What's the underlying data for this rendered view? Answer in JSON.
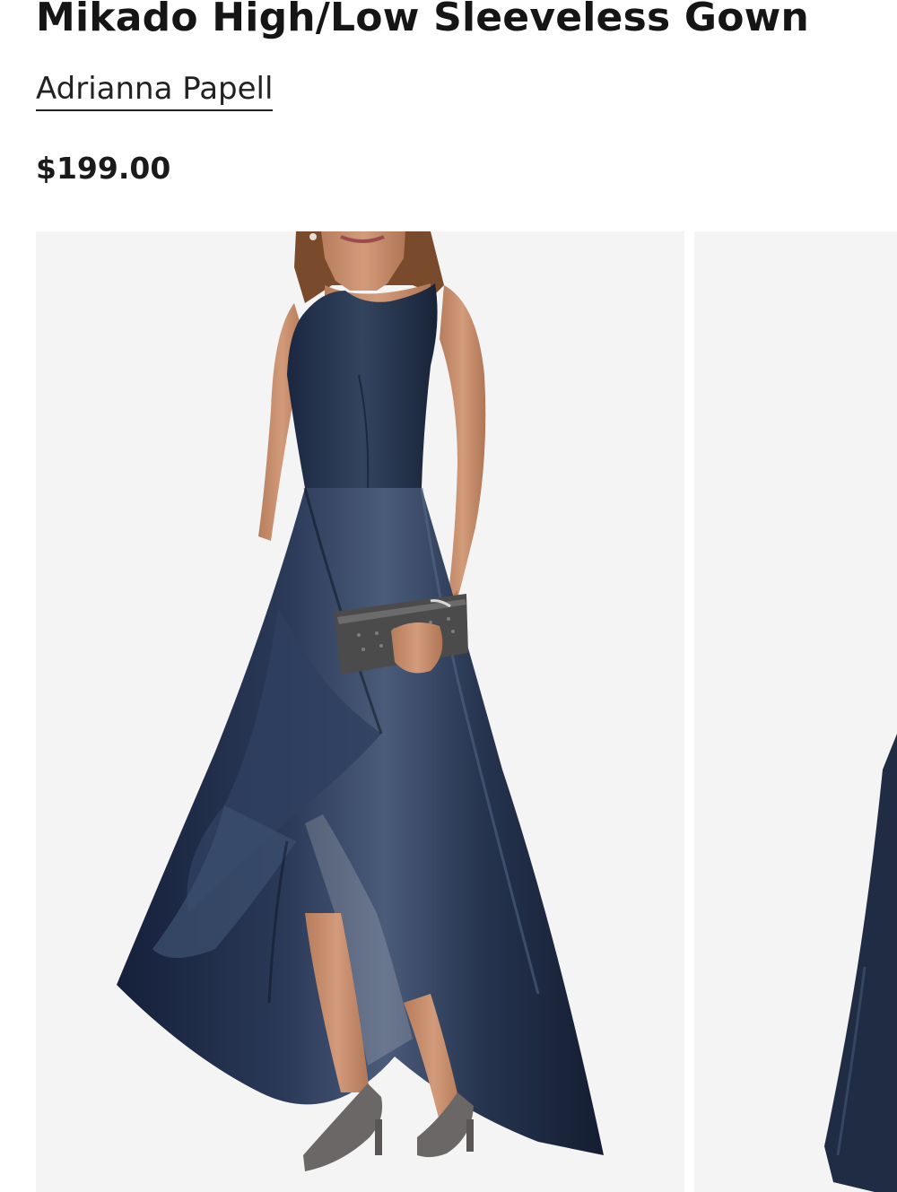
{
  "product": {
    "title": "Mikado High/Low Sleeveless Gown",
    "brand": "Adrianna Papell",
    "price": "$199.00"
  },
  "gallery": {
    "images": [
      {
        "label": "navy high-low sleeveless gown front view with clutch"
      },
      {
        "label": "partial second product image"
      }
    ]
  },
  "colors": {
    "gown": "#1f2c44",
    "gown_highlight": "#4d5f7c",
    "gown_shadow": "#111a2b",
    "skin": "#c89070",
    "image_bg": "#f4f4f4",
    "text": "#1a1a1a"
  }
}
